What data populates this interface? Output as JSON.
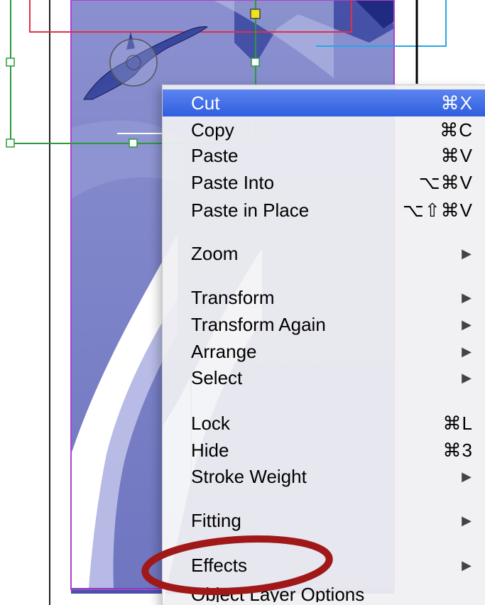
{
  "context_menu": {
    "items": [
      {
        "label": "Cut",
        "shortcut": "⌘X",
        "has_submenu": false,
        "highlighted": true
      },
      {
        "label": "Copy",
        "shortcut": "⌘C",
        "has_submenu": false
      },
      {
        "label": "Paste",
        "shortcut": "⌘V",
        "has_submenu": false
      },
      {
        "label": "Paste Into",
        "shortcut": "⌥⌘V",
        "has_submenu": false
      },
      {
        "label": "Paste in Place",
        "shortcut": "⌥⇧⌘V",
        "has_submenu": false
      },
      {
        "label": "Zoom",
        "shortcut": "",
        "has_submenu": true
      },
      {
        "label": "Transform",
        "shortcut": "",
        "has_submenu": true
      },
      {
        "label": "Transform Again",
        "shortcut": "",
        "has_submenu": true
      },
      {
        "label": "Arrange",
        "shortcut": "",
        "has_submenu": true
      },
      {
        "label": "Select",
        "shortcut": "",
        "has_submenu": true
      },
      {
        "label": "Lock",
        "shortcut": "⌘L",
        "has_submenu": false
      },
      {
        "label": "Hide",
        "shortcut": "⌘3",
        "has_submenu": false
      },
      {
        "label": "Stroke Weight",
        "shortcut": "",
        "has_submenu": true
      },
      {
        "label": "Fitting",
        "shortcut": "",
        "has_submenu": true
      },
      {
        "label": "Effects",
        "shortcut": "",
        "has_submenu": true,
        "circled": true
      },
      {
        "label": "Object Layer Options",
        "shortcut": "",
        "has_submenu": false
      }
    ],
    "submenu_arrow": "▶",
    "highlight_color": "#3a6ae6"
  },
  "annotation": {
    "color": "#a01818",
    "target": "Effects"
  },
  "artwork": {
    "fill_color": "#7a80c4",
    "frame_color": "#b040d0"
  }
}
